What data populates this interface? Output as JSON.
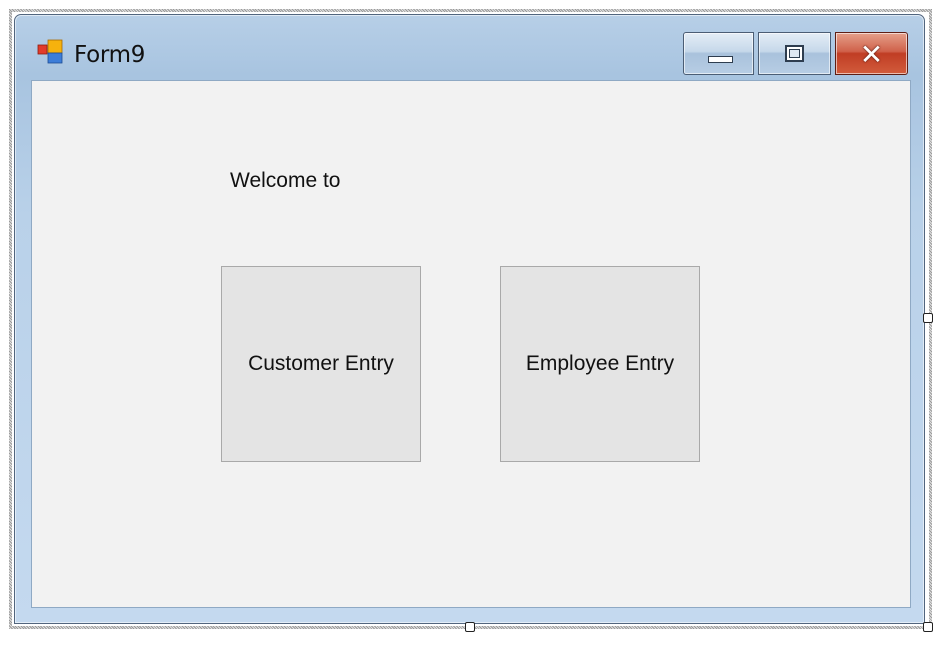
{
  "window": {
    "title": "Form9",
    "icon": "windows-form-icon",
    "controls": {
      "minimize": "minimize-icon",
      "maximize": "maximize-icon",
      "close": "close-icon"
    }
  },
  "form": {
    "welcome_label": "Welcome to",
    "buttons": {
      "customer_entry": "Customer Entry",
      "employee_entry": "Employee Entry"
    }
  },
  "colors": {
    "title_bar": "#a8c4e0",
    "client_background": "#f2f2f2",
    "button_face": "#e4e4e4",
    "close_button": "#c03d24"
  }
}
